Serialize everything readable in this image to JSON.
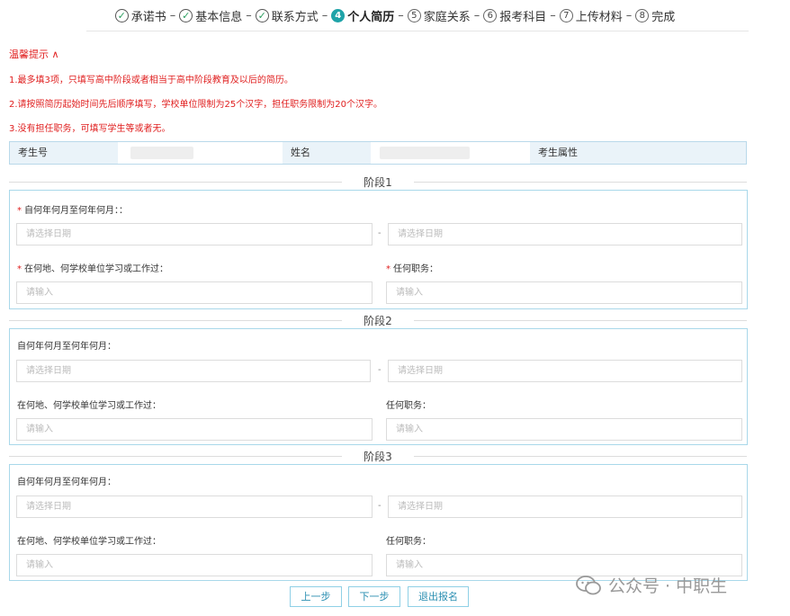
{
  "steps": [
    {
      "num": "✓",
      "label": "承诺书",
      "state": "done"
    },
    {
      "num": "✓",
      "label": "基本信息",
      "state": "done"
    },
    {
      "num": "✓",
      "label": "联系方式",
      "state": "done"
    },
    {
      "num": "4",
      "label": "个人简历",
      "state": "current"
    },
    {
      "num": "5",
      "label": "家庭关系",
      "state": "todo"
    },
    {
      "num": "6",
      "label": "报考科目",
      "state": "todo"
    },
    {
      "num": "7",
      "label": "上传材料",
      "state": "todo"
    },
    {
      "num": "8",
      "label": "完成",
      "state": "todo"
    }
  ],
  "tips": {
    "title": "温馨提示 ∧",
    "items": [
      "1.最多填3项，只填写高中阶段或者相当于高中阶段教育及以后的简历。",
      "2.请按照简历起始时间先后顺序填写，学校单位限制为25个汉字，担任职务限制为20个汉字。",
      "3.没有担任职务，可填写学生等或者无。"
    ]
  },
  "info": {
    "exam_no_label": "考生号",
    "name_label": "姓名",
    "attr_label": "考生属性"
  },
  "stages": [
    {
      "title": "阶段1",
      "period_label": "自何年何月至何年何月：：",
      "start_placeholder": "请选择日期",
      "end_placeholder": "请选择日期",
      "dash": "-",
      "place_label": "在何地、何学校单位学习或工作过：",
      "place_placeholder": "请输入",
      "position_label": "任何职务：",
      "position_placeholder": "请输入",
      "required_mark": "*"
    },
    {
      "title": "阶段2",
      "period_label": "自何年何月至何年何月：",
      "start_placeholder": "请选择日期",
      "end_placeholder": "请选择日期",
      "dash": "-",
      "place_label": "在何地、何学校单位学习或工作过：",
      "place_placeholder": "请输入",
      "position_label": "任何职务：",
      "position_placeholder": "请输入"
    },
    {
      "title": "阶段3",
      "period_label": "自何年何月至何年何月：",
      "start_placeholder": "请选择日期",
      "end_placeholder": "请选择日期",
      "dash": "-",
      "place_label": "在何地、何学校单位学习或工作过：",
      "place_placeholder": "请输入",
      "position_label": "任何职务：",
      "position_placeholder": "请输入"
    }
  ],
  "buttons": {
    "prev": "上一步",
    "next": "下一步",
    "exit": "退出报名"
  },
  "watermark": "公众号 · 中职生"
}
